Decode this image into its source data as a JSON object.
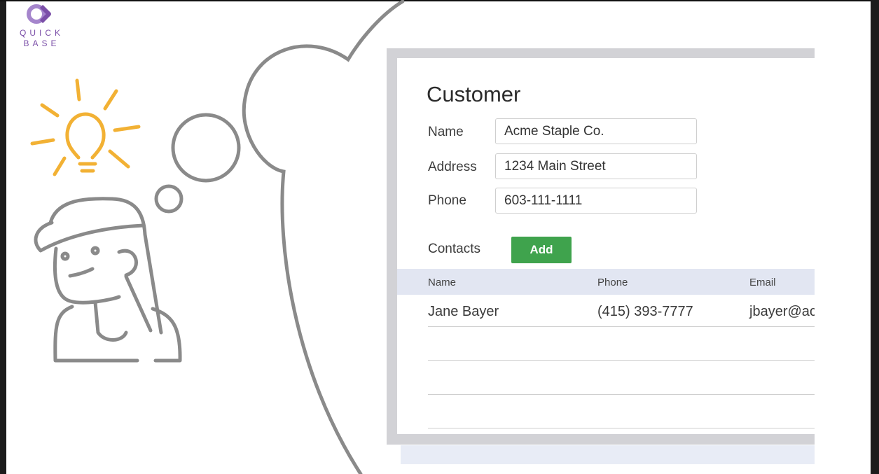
{
  "logo": {
    "line1": "QUICK",
    "line2": "BASE",
    "color": "#7b4fa8"
  },
  "illustration": {
    "character": "woman-with-cap",
    "idea_icon": "lightbulb-icon",
    "idea_color": "#f2b134",
    "line_color": "#8a8a8a"
  },
  "form": {
    "title": "Customer",
    "fields": [
      {
        "label": "Name",
        "value": "Acme Staple Co."
      },
      {
        "label": "Address",
        "value": "1234 Main Street"
      },
      {
        "label": "Phone",
        "value": "603-111-1111"
      }
    ],
    "contacts_label": "Contacts",
    "add_label": "Add",
    "add_color": "#3fa34d"
  },
  "contacts_table": {
    "columns": [
      "Name",
      "Phone",
      "Email"
    ],
    "rows": [
      {
        "name": "Jane Bayer",
        "phone": "(415) 393-7777",
        "email": "jbayer@ac"
      }
    ],
    "header_color": "#e2e6f2"
  }
}
